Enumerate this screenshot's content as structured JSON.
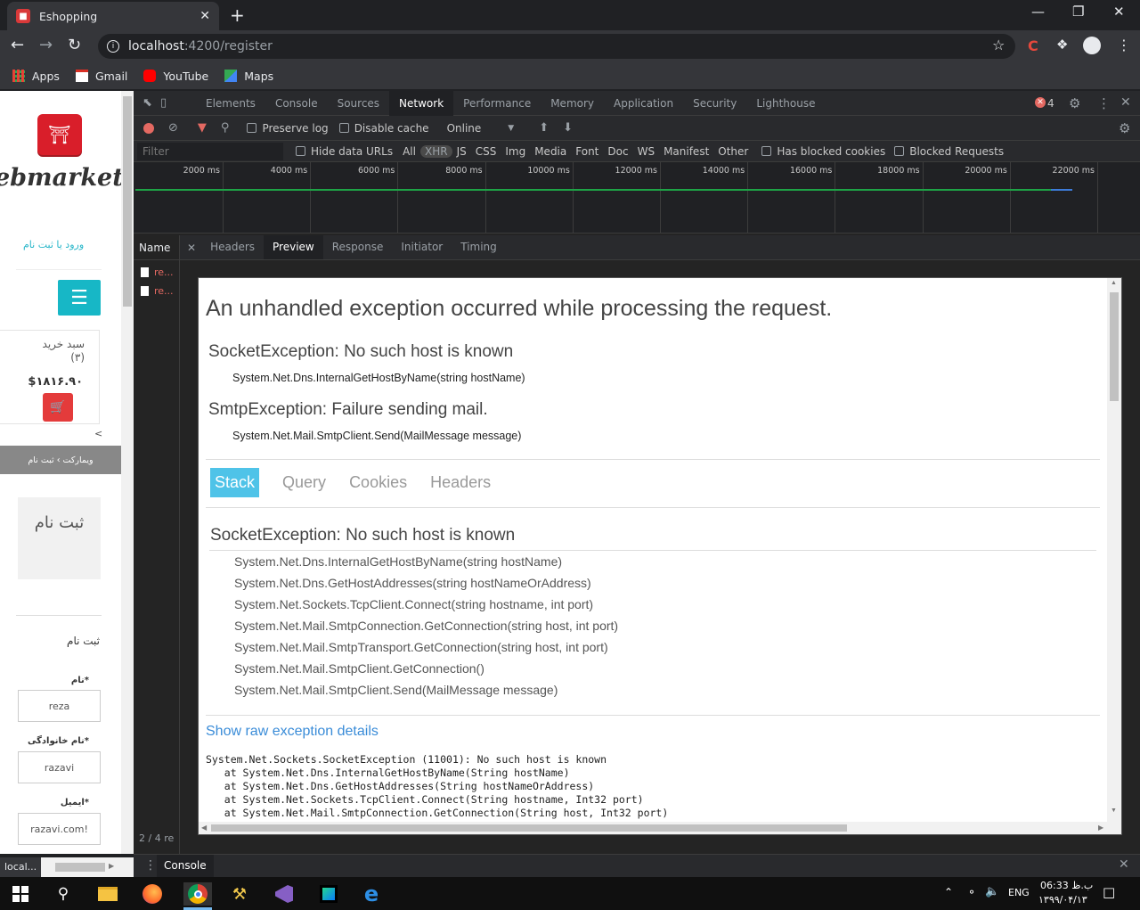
{
  "browser": {
    "tab_title": "Eshopping",
    "url_host": "localhost",
    "url_path": ":4200/register",
    "bookmarks": [
      "Apps",
      "Gmail",
      "YouTube",
      "Maps"
    ]
  },
  "page": {
    "brand": "ebmarket",
    "login_link": "ورود یا ثبت نام",
    "cart_title": "سبد خرید",
    "cart_count": "(۳)",
    "cart_price": "$۱۸۱۶.۹۰",
    "breadcrumb": "ویمارکت › ثبت نام",
    "register_box": "ثبت نام",
    "section_title": "ثبت نام",
    "fields": [
      {
        "label": "نام*",
        "value": "reza"
      },
      {
        "label": "نام خانوادگی*",
        "value": "razavi"
      },
      {
        "label": "ایمیل*",
        "value": "razavi.com!"
      }
    ]
  },
  "devtools": {
    "tabs": [
      "Elements",
      "Console",
      "Sources",
      "Network",
      "Performance",
      "Memory",
      "Application",
      "Security",
      "Lighthouse"
    ],
    "active_tab": "Network",
    "error_count": "4",
    "net_toolbar": {
      "preserve_log": "Preserve log",
      "disable_cache": "Disable cache",
      "throttle": "Online"
    },
    "filter_placeholder": "Filter",
    "hide_data_urls": "Hide data URLs",
    "types": [
      "All",
      "XHR",
      "JS",
      "CSS",
      "Img",
      "Media",
      "Font",
      "Doc",
      "WS",
      "Manifest",
      "Other"
    ],
    "selected_type": "XHR",
    "has_blocked": "Has blocked cookies",
    "blocked_requests": "Blocked Requests",
    "timeline_ticks": [
      "2000 ms",
      "4000 ms",
      "6000 ms",
      "8000 ms",
      "10000 ms",
      "12000 ms",
      "14000 ms",
      "16000 ms",
      "18000 ms",
      "20000 ms",
      "22000 ms"
    ],
    "name_header": "Name",
    "requests": [
      "re...",
      "re..."
    ],
    "footer": "2 / 4 re",
    "detail_tabs": [
      "Headers",
      "Preview",
      "Response",
      "Initiator",
      "Timing"
    ],
    "active_detail": "Preview",
    "drawer_label": "Console"
  },
  "preview": {
    "title": "An unhandled exception occurred while processing the request.",
    "exceptions": [
      {
        "name": "SocketException: No such host is known",
        "frame": "System.Net.Dns.InternalGetHostByName(string hostName)"
      },
      {
        "name": "SmtpException: Failure sending mail.",
        "frame": "System.Net.Mail.SmtpClient.Send(MailMessage message)"
      }
    ],
    "tabs": [
      "Stack",
      "Query",
      "Cookies",
      "Headers"
    ],
    "active_tab": "Stack",
    "stack_title": "SocketException: No such host is known",
    "stack": [
      "System.Net.Dns.InternalGetHostByName(string hostName)",
      "System.Net.Dns.GetHostAddresses(string hostNameOrAddress)",
      "System.Net.Sockets.TcpClient.Connect(string hostname, int port)",
      "System.Net.Mail.SmtpConnection.GetConnection(string host, int port)",
      "System.Net.Mail.SmtpTransport.GetConnection(string host, int port)",
      "System.Net.Mail.SmtpClient.GetConnection()",
      "System.Net.Mail.SmtpClient.Send(MailMessage message)"
    ],
    "raw_link": "Show raw exception details",
    "raw": "System.Net.Sockets.SocketException (11001): No such host is known\n   at System.Net.Dns.InternalGetHostByName(String hostName)\n   at System.Net.Dns.GetHostAddresses(String hostNameOrAddress)\n   at System.Net.Sockets.TcpClient.Connect(String hostname, Int32 port)\n   at System.Net.Mail.SmtpConnection.GetConnection(String host, Int32 port)"
  },
  "statusbar": {
    "url": "local..."
  },
  "taskbar": {
    "lang": "ENG",
    "time": "06:33 ب.ظ",
    "date": "۱۳۹۹/۰۴/۱۳"
  }
}
